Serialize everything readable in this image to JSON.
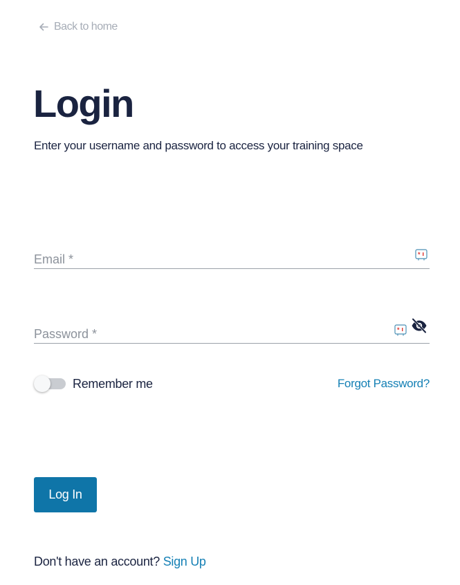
{
  "back_link": {
    "label": "Back to home",
    "icon": "arrow-left-icon"
  },
  "title": "Login",
  "subtitle": "Enter your username and password to access your training space",
  "email": {
    "placeholder": "Email *",
    "value": ""
  },
  "password": {
    "placeholder": "Password *",
    "value": ""
  },
  "remember": {
    "label": "Remember me",
    "checked": false
  },
  "forgot_password": "Forgot Password?",
  "login_button": "Log In",
  "signup": {
    "prompt": "Don't have an account?",
    "link": "Sign Up"
  },
  "colors": {
    "heading": "#1a2340",
    "accent": "#1580b5",
    "button": "#0f75a8",
    "muted": "#a6acb6"
  }
}
